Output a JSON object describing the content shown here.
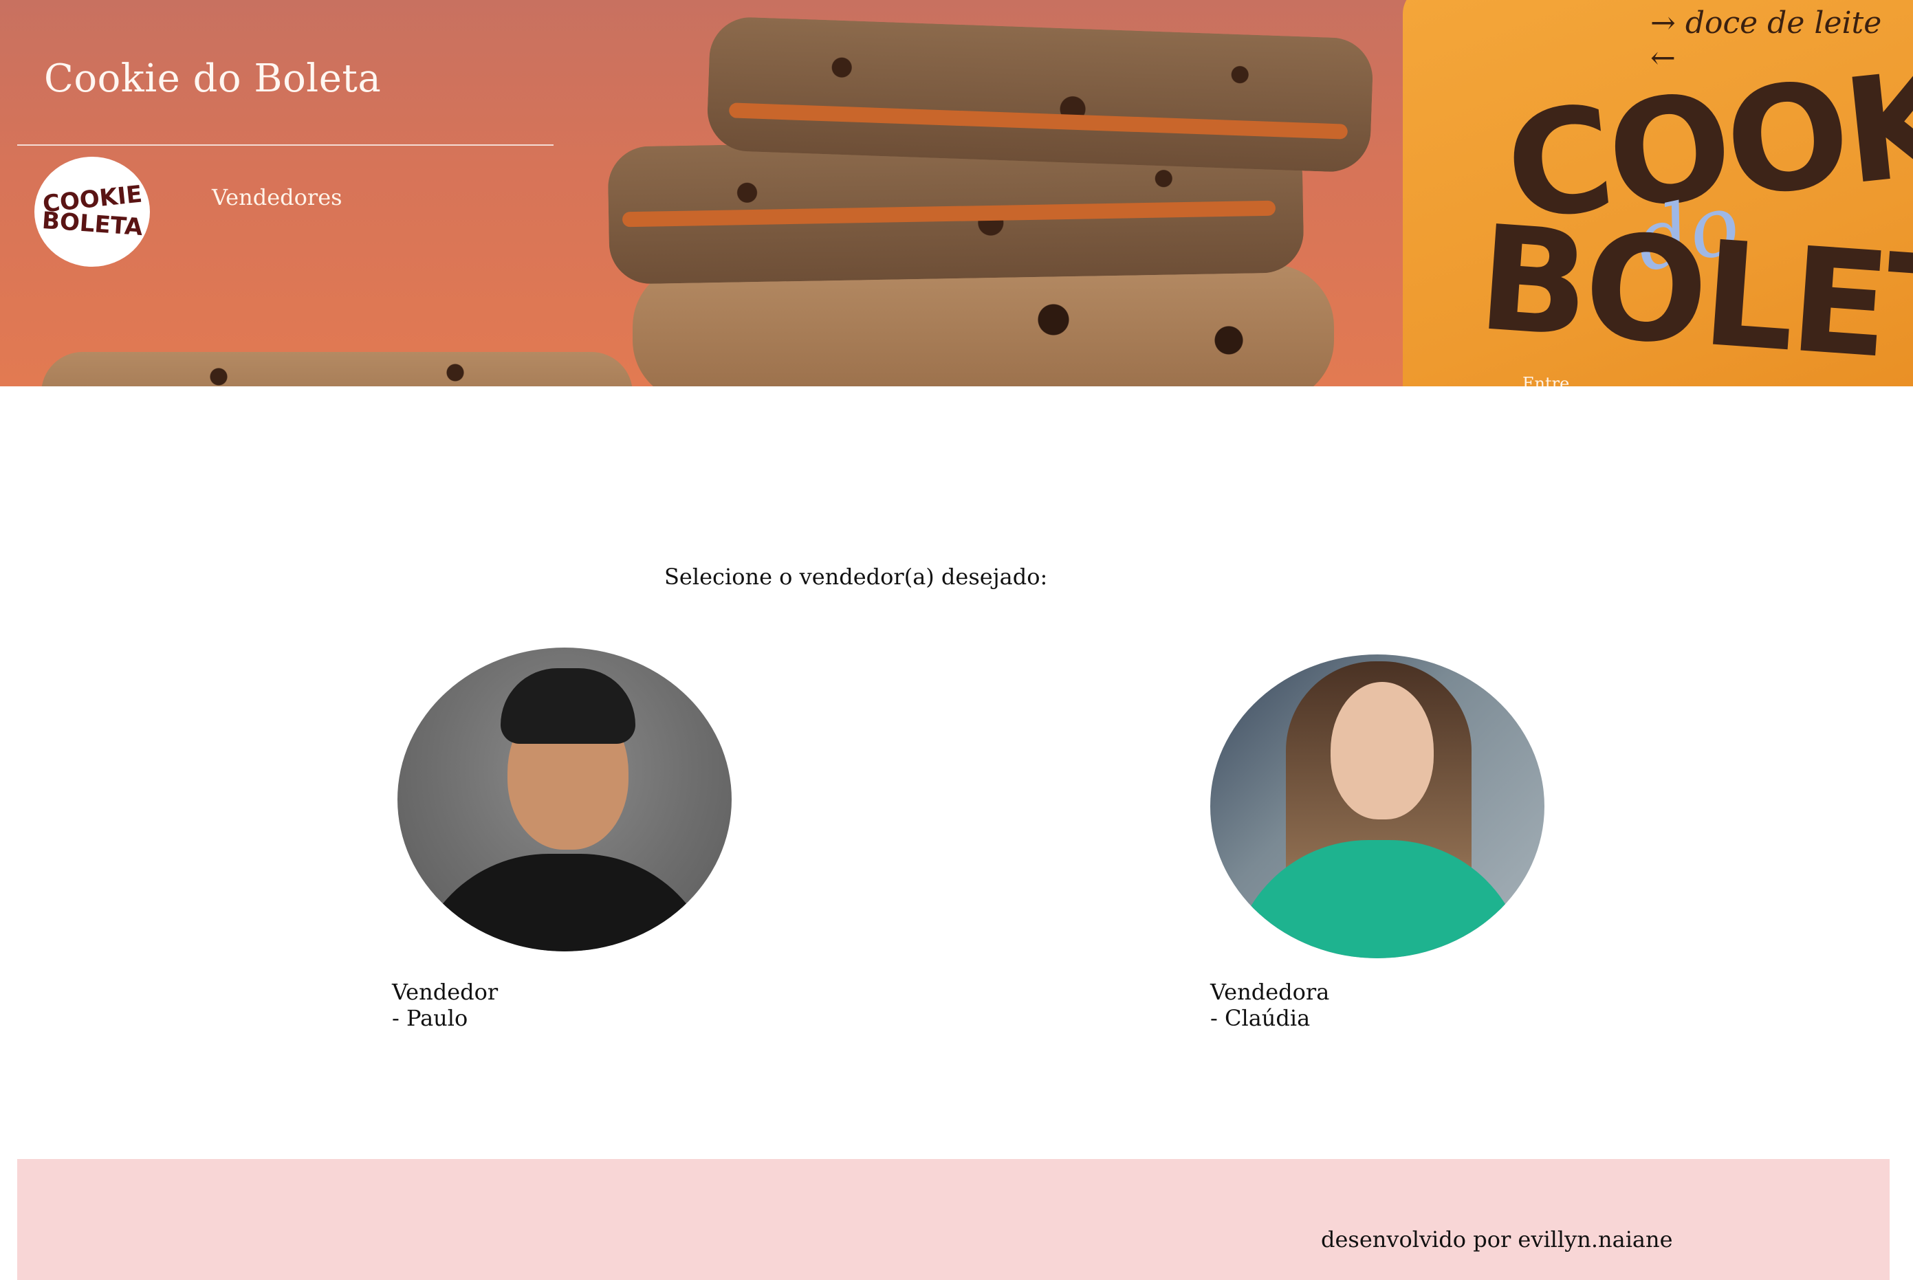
{
  "header": {
    "site_title": "Cookie do Boleta",
    "logo_text_line1": "COOKIE",
    "logo_text_line2": "BOLETA",
    "nav": [
      {
        "label": "Vendedores"
      }
    ],
    "hero_overflow_text": "Entre"
  },
  "hero_artwork": {
    "package_tag": "→ doce de leite ←",
    "package_brand_line1": "COOKIE",
    "package_brand_script": "do",
    "package_brand_line2": "BOLETA"
  },
  "main": {
    "prompt": "Selecione o vendedor(a) desejado:",
    "sellers": [
      {
        "label": "Vendedor - Paulo"
      },
      {
        "label": "Vendedora - Claúdia"
      }
    ]
  },
  "footer": {
    "credit": "desenvolvido por evillyn.naiane",
    "background_color": "#f8d6d6"
  },
  "colors": {
    "hero_background": "#d77458",
    "package_orange": "#f4a63a",
    "logo_brown": "#5a1414"
  }
}
